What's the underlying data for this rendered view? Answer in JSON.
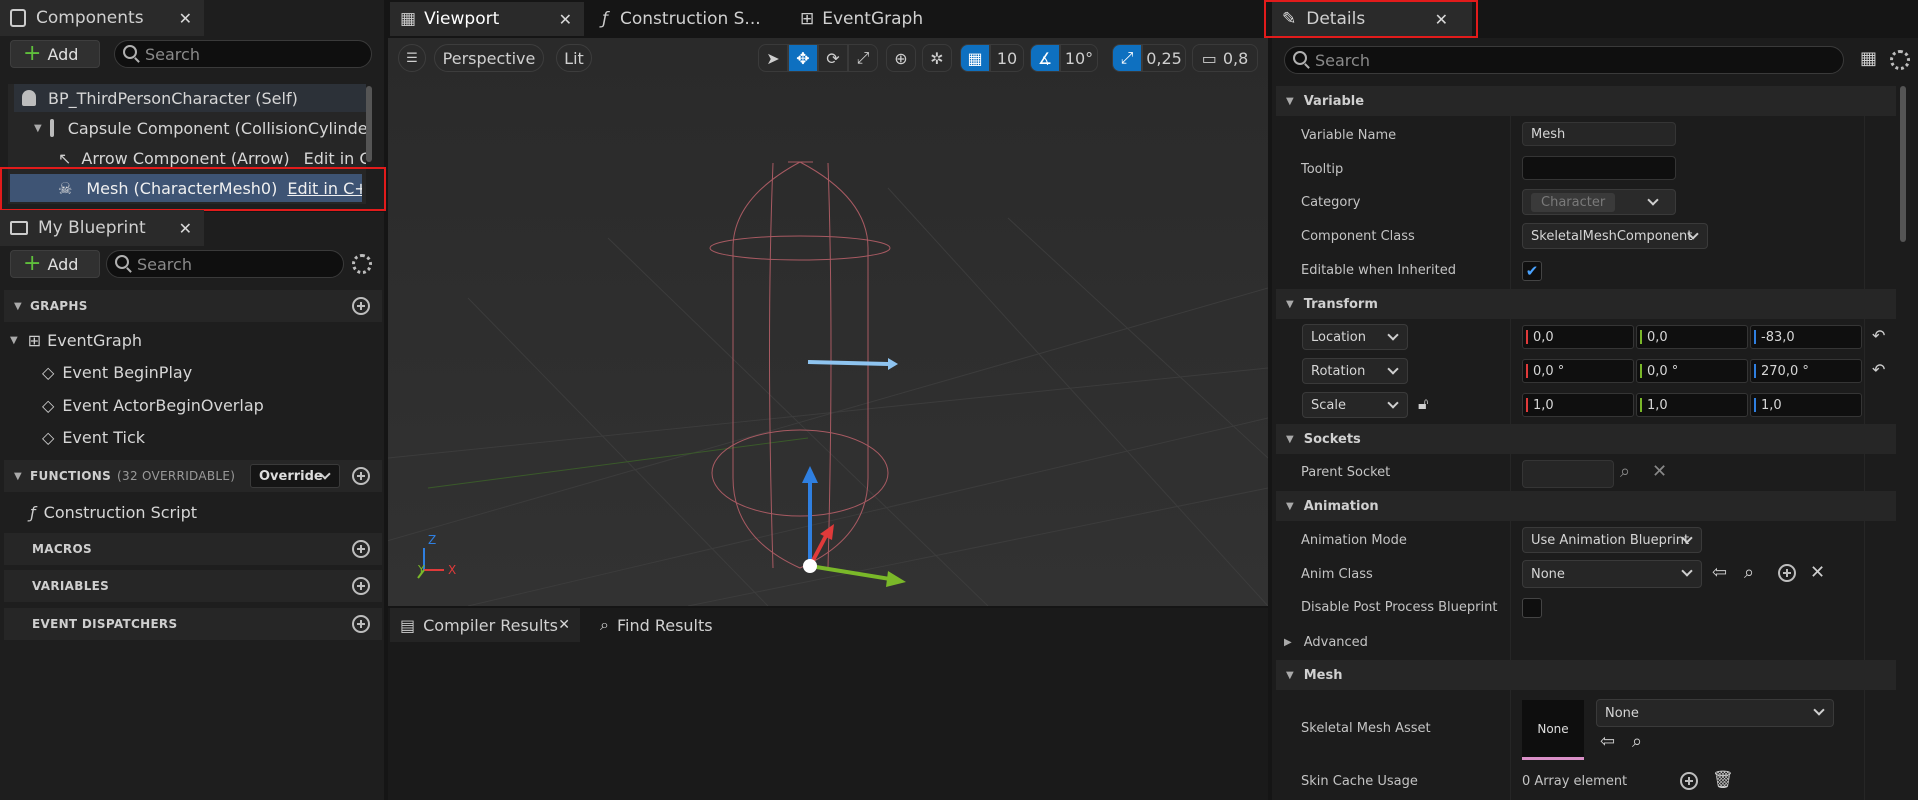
{
  "components_panel": {
    "title": "Components",
    "add_label": "Add",
    "search_placeholder": "Search",
    "items": [
      {
        "label": "BP_ThirdPersonCharacter (Self)",
        "edit": ""
      },
      {
        "label": "Capsule Component (CollisionCylinde",
        "edit": ""
      },
      {
        "label": "Arrow Component (Arrow)",
        "edit": "Edit in C"
      },
      {
        "label": "Mesh (CharacterMesh0)",
        "edit": "Edit in C++"
      }
    ]
  },
  "my_blueprint": {
    "title": "My Blueprint",
    "add_label": "Add",
    "search_placeholder": "Search",
    "graphs_header": "GRAPHS",
    "event_graph": "EventGraph",
    "events": [
      "Event BeginPlay",
      "Event ActorBeginOverlap",
      "Event Tick"
    ],
    "functions_header": "FUNCTIONS",
    "functions_count": "(32 OVERRIDABLE)",
    "override_label": "Override",
    "construction_script": "Construction Script",
    "macros_header": "MACROS",
    "variables_header": "VARIABLES",
    "dispatchers_header": "EVENT DISPATCHERS"
  },
  "center_tabs": [
    "Viewport",
    "Construction S...",
    "EventGraph"
  ],
  "viewport_toolbar": {
    "perspective": "Perspective",
    "lit": "Lit",
    "grid_snap": "10",
    "rot_snap": "10°",
    "scale_snap": "0,25",
    "camera_speed": "0,8"
  },
  "bottom_tabs": [
    "Compiler Results",
    "Find Results"
  ],
  "details": {
    "title": "Details",
    "search_placeholder": "Search",
    "sections": {
      "variable": "Variable",
      "transform": "Transform",
      "sockets": "Sockets",
      "animation": "Animation",
      "advanced": "Advanced",
      "mesh": "Mesh"
    },
    "variable_name_label": "Variable Name",
    "variable_name_value": "Mesh",
    "tooltip_label": "Tooltip",
    "category_label": "Category",
    "category_value": "Character",
    "component_class_label": "Component Class",
    "component_class_value": "SkeletalMeshComponent",
    "editable_label": "Editable when Inherited",
    "editable_checked": true,
    "location_label": "Location",
    "location_values": [
      "0,0",
      "0,0",
      "-83,0"
    ],
    "rotation_label": "Rotation",
    "rotation_values": [
      "0,0 °",
      "0,0 °",
      "270,0 °"
    ],
    "scale_label": "Scale",
    "scale_values": [
      "1,0",
      "1,0",
      "1,0"
    ],
    "parent_socket_label": "Parent Socket",
    "anim_mode_label": "Animation Mode",
    "anim_mode_value": "Use Animation Blueprint",
    "anim_class_label": "Anim Class",
    "anim_class_value": "None",
    "disable_pp_label": "Disable Post Process Blueprint",
    "skeletal_mesh_label": "Skeletal Mesh Asset",
    "skeletal_mesh_thumb": "None",
    "skeletal_mesh_value": "None",
    "skin_cache_label": "Skin Cache Usage",
    "skin_cache_value": "0 Array element"
  },
  "colors": {
    "accent_blue": "#0e70c0",
    "highlight_red": "#e21b1b",
    "x_axis": "#e03a3a",
    "y_axis": "#7ab829",
    "z_axis": "#2f7fe0"
  }
}
